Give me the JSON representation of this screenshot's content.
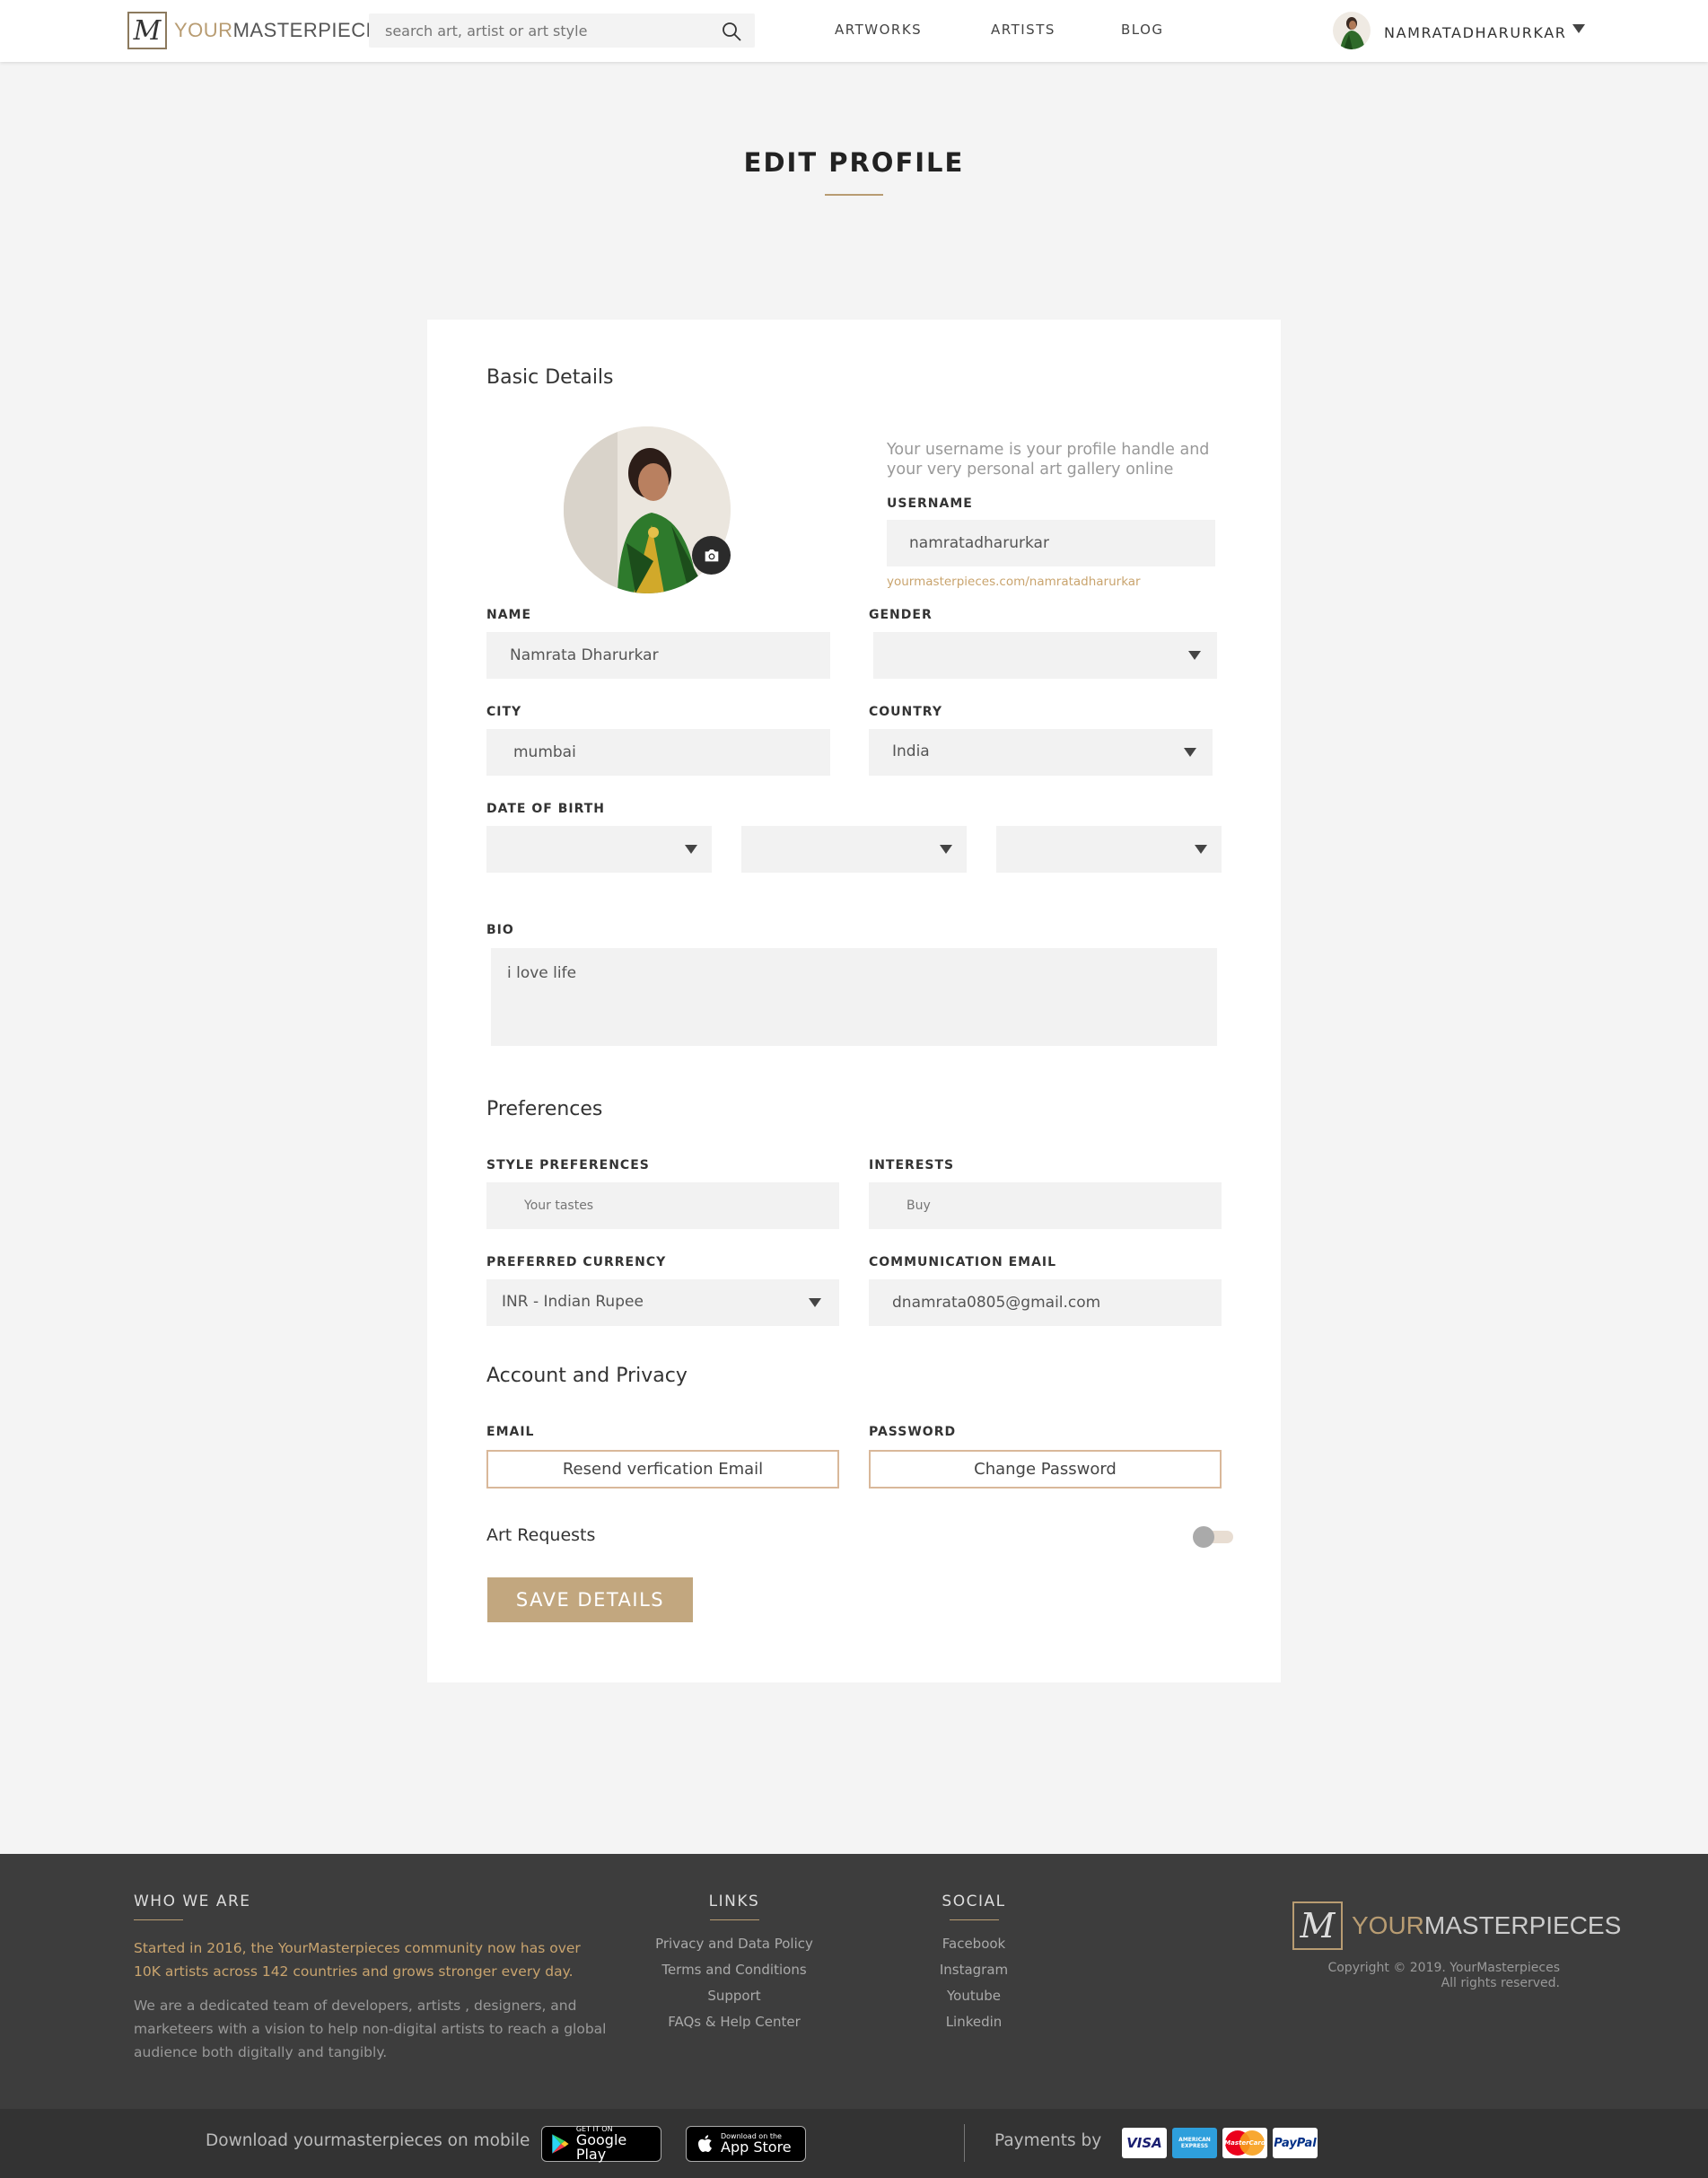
{
  "header": {
    "logo": {
      "mark": "M",
      "word_accent": "YOUR",
      "word_main": "MASTERPIECES"
    },
    "search": {
      "placeholder": "search art, artist or art style"
    },
    "nav": [
      "ARTWORKS",
      "ARTISTS",
      "BLOG"
    ],
    "user": {
      "name": "NAMRATADHARURKAR"
    }
  },
  "page": {
    "title": "EDIT PROFILE"
  },
  "basic": {
    "title": "Basic Details",
    "username_hint": "Your username is your profile handle and your very personal art gallery online",
    "username_label": "USERNAME",
    "username_value": "namratadharurkar",
    "profile_url": "yourmasterpieces.com/namratadharurkar",
    "name_label": "NAME",
    "name_value": "Namrata Dharurkar",
    "gender_label": "GENDER",
    "gender_value": "",
    "city_label": "CITY",
    "city_value": "mumbai",
    "country_label": "COUNTRY",
    "country_value": "India",
    "dob_label": "DATE OF BIRTH",
    "dob": {
      "day": "",
      "month": "",
      "year": ""
    },
    "bio_label": "BIO",
    "bio_value": "i love life"
  },
  "preferences": {
    "title": "Preferences",
    "style_label": "STYLE PREFERENCES",
    "style_placeholder": "Your tastes",
    "interests_label": "INTERESTS",
    "interests_placeholder": "Buy",
    "currency_label": "PREFERRED CURRENCY",
    "currency_value": "INR - Indian Rupee",
    "comm_email_label": "COMMUNICATION EMAIL",
    "comm_email_value": "dnamrata0805@gmail.com"
  },
  "account": {
    "title": "Account and Privacy",
    "email_label": "EMAIL",
    "resend_button": "Resend verfication Email",
    "password_label": "PASSWORD",
    "change_password_button": "Change Password",
    "art_requests_label": "Art Requests",
    "art_requests_enabled": false,
    "save_button": "SAVE DETAILS"
  },
  "footer": {
    "who_title": "WHO WE ARE",
    "who_text_1": "Started in 2016, the YourMasterpieces community now has over 10K artists across 142 countries and grows stronger every day.",
    "who_text_2": "We are a dedicated team of developers, artists , designers, and marketeers with a vision to help non-digital artists to reach a global audience both digitally and tangibly.",
    "links_title": "LINKS",
    "links": [
      "Privacy and Data Policy",
      "Terms and Conditions",
      "Support",
      "FAQs & Help Center"
    ],
    "social_title": "SOCIAL",
    "social": [
      "Facebook",
      "Instagram",
      "Youtube",
      "Linkedin"
    ],
    "copyright_1": "Copyright © 2019. YourMasterpieces",
    "copyright_2": "All rights reserved.",
    "download_text": "Download yourmasterpieces on mobile",
    "google_play": {
      "small": "GET IT ON",
      "big": "Google Play"
    },
    "app_store": {
      "small": "Download on the",
      "big": "App Store"
    },
    "payments_text": "Payments by",
    "payment_methods": [
      "VISA",
      "AMERICAN EXPRESS",
      "MasterCard",
      "PayPal"
    ]
  },
  "colors": {
    "accent": "#b89c72",
    "button": "#c2a77f",
    "footer": "#3d3d3d",
    "footer_highlight": "#c9a46e"
  }
}
